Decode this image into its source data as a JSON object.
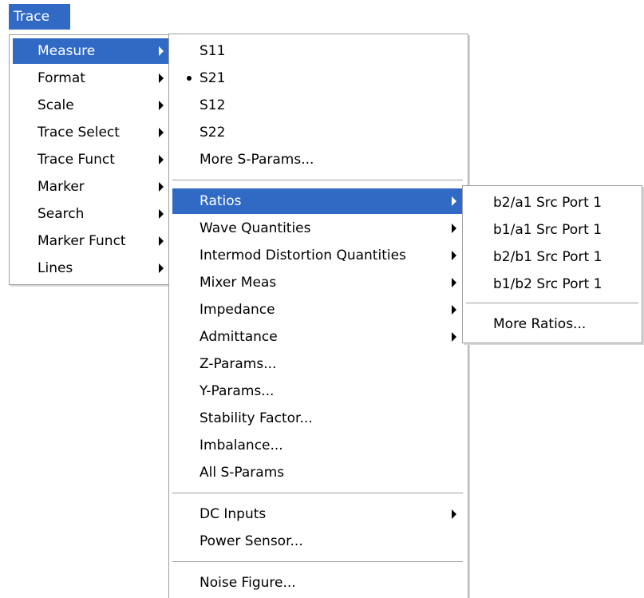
{
  "colors": {
    "highlight": "#316ac5",
    "highlight_text": "#ffffff",
    "menu_bg": "#ffffff",
    "menu_border": "#a0a0a0"
  },
  "menubar": {
    "trace_label": "Trace"
  },
  "trace_menu": {
    "items": [
      {
        "label": "Measure"
      },
      {
        "label": "Format"
      },
      {
        "label": "Scale"
      },
      {
        "label": "Trace Select"
      },
      {
        "label": "Trace Funct"
      },
      {
        "label": "Marker"
      },
      {
        "label": "Search"
      },
      {
        "label": "Marker Funct"
      },
      {
        "label": "Lines"
      }
    ]
  },
  "measure_menu": {
    "s11": "S11",
    "s21": "S21",
    "s12": "S12",
    "s22": "S22",
    "more_sparams": "More S-Params...",
    "ratios": "Ratios",
    "wave_quantities": "Wave Quantities",
    "intermod": "Intermod Distortion Quantities",
    "mixer_meas": "Mixer Meas",
    "impedance": "Impedance",
    "admittance": "Admittance",
    "z_params": "Z-Params...",
    "y_params": "Y-Params...",
    "stability": "Stability Factor...",
    "imbalance": "Imbalance...",
    "all_sparams": "All S-Params",
    "dc_inputs": "DC Inputs",
    "power_sensor": "Power Sensor...",
    "noise_figure": "Noise Figure..."
  },
  "ratios_menu": {
    "b2a1": "b2/a1 Src Port 1",
    "b1a1": "b1/a1 Src Port 1",
    "b2b1": "b2/b1 Src Port 1",
    "b1b2": "b1/b2 Src Port 1",
    "more_ratios": "More Ratios..."
  },
  "icons": {
    "submenu": "submenu-arrow-icon",
    "selected": "radio-bullet-icon"
  }
}
